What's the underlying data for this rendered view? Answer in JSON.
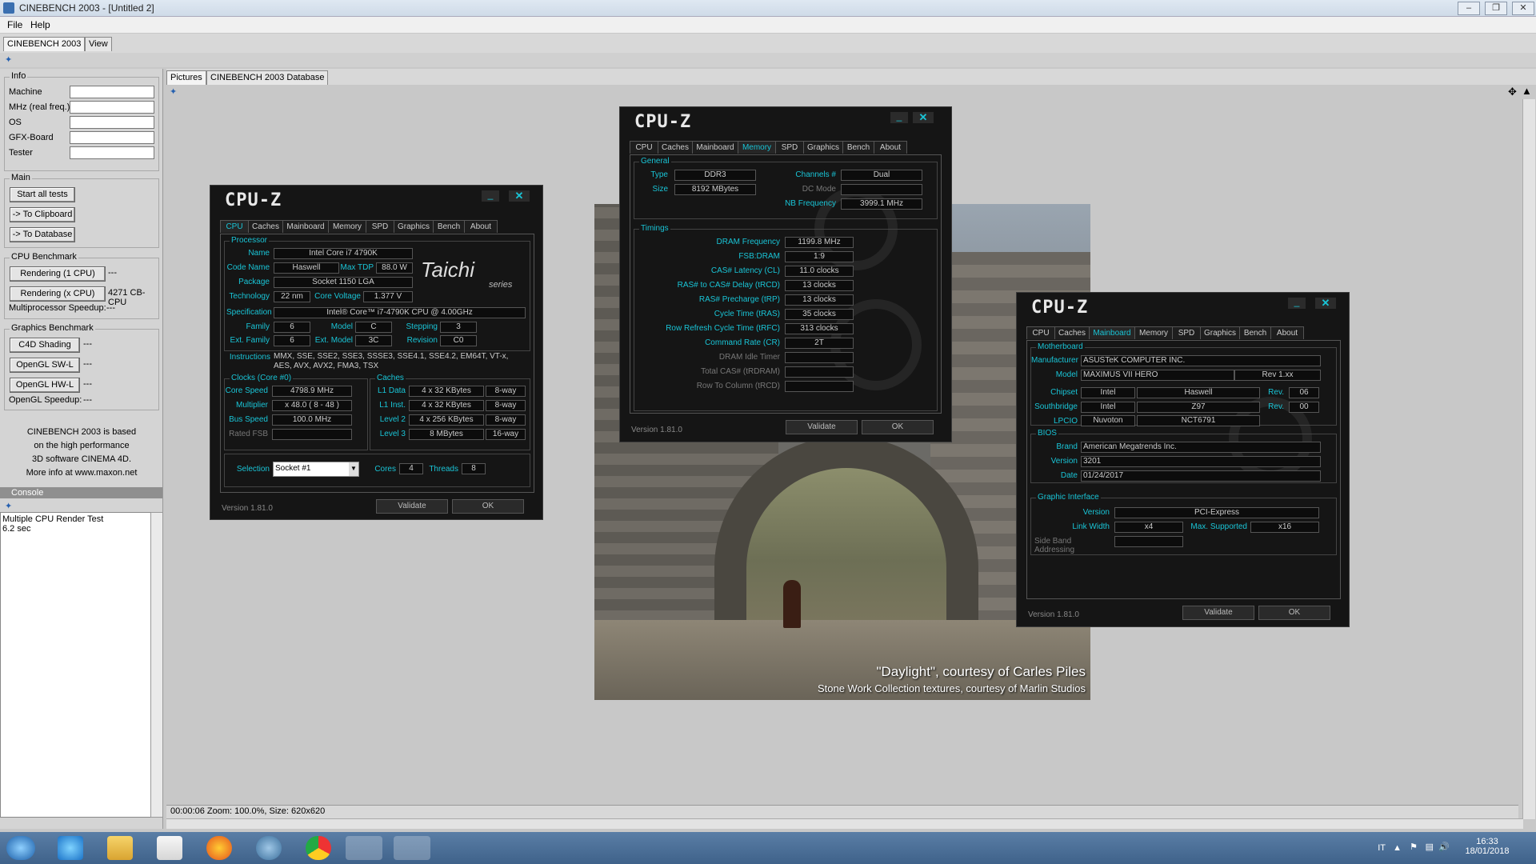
{
  "window": {
    "title": "CINEBENCH 2003 - [Untitled 2]"
  },
  "menu": [
    "File",
    "Help"
  ],
  "top_tabs": [
    "CINEBENCH 2003",
    "View"
  ],
  "info": {
    "label": "Info",
    "fields": [
      "Machine",
      "MHz (real freq.)",
      "OS",
      "GFX-Board",
      "Tester"
    ]
  },
  "main_group": {
    "label": "Main",
    "buttons": [
      "Start all tests",
      "-> To Clipboard",
      "-> To Database"
    ]
  },
  "cpu_bench": {
    "label": "CPU Benchmark",
    "render1": "Rendering (1 CPU)",
    "render1_result": "---",
    "renderx": "Rendering (x CPU)",
    "renderx_result": "4271 CB-CPU",
    "mp_label": "Multiprocessor Speedup:",
    "mp_value": "---"
  },
  "gfx_bench": {
    "label": "Graphics Benchmark",
    "c4d": "C4D Shading",
    "c4d_result": "---",
    "swl": "OpenGL SW-L",
    "swl_result": "---",
    "hwl": "OpenGL HW-L",
    "hwl_result": "---",
    "speedup_label": "OpenGL Speedup:",
    "speedup_value": "---"
  },
  "about_text": [
    "CINEBENCH 2003 is based",
    "on the high performance",
    "3D software CINEMA 4D.",
    "More info at www.maxon.net"
  ],
  "console": {
    "label": "Console",
    "lines": [
      "Multiple CPU Render Test",
      "6.2 sec"
    ]
  },
  "view_tabs": [
    "Pictures",
    "CINEBENCH 2003 Database"
  ],
  "status": "00:00:06  Zoom: 100.0%, Size: 620x620",
  "render_caption": {
    "line1": "\"Daylight\", courtesy of Carles Piles",
    "line2": "Stone Work Collection textures, courtesy of Marlin Studios"
  },
  "cpuz_tabs": [
    "CPU",
    "Caches",
    "Mainboard",
    "Memory",
    "SPD",
    "Graphics",
    "Bench",
    "About"
  ],
  "cpuz_cpu": {
    "logo": "CPU-Z",
    "processor_label": "Processor",
    "name_label": "Name",
    "name": "Intel Core i7 4790K",
    "codename_label": "Code Name",
    "codename": "Haswell",
    "maxtdp_label": "Max TDP",
    "maxtdp": "88.0 W",
    "package_label": "Package",
    "package": "Socket 1150 LGA",
    "tech_label": "Technology",
    "tech": "22 nm",
    "voltage_label": "Core Voltage",
    "voltage": "1.377 V",
    "spec_label": "Specification",
    "spec": "Intel® Core™ i7-4790K CPU @ 4.00GHz",
    "family_label": "Family",
    "family": "6",
    "model_label": "Model",
    "model": "C",
    "stepping_label": "Stepping",
    "stepping": "3",
    "extfamily_label": "Ext. Family",
    "extfamily": "6",
    "extmodel_label": "Ext. Model",
    "extmodel": "3C",
    "revision_label": "Revision",
    "revision": "C0",
    "instr_label": "Instructions",
    "instr": "MMX, SSE, SSE2, SSE3, SSSE3, SSE4.1, SSE4.2, EM64T, VT-x, AES, AVX, AVX2, FMA3, TSX",
    "brand_line1": "Taichi",
    "brand_line2": "series",
    "clocks_label": "Clocks (Core #0)",
    "corespeed_label": "Core Speed",
    "corespeed": "4798.9 MHz",
    "mult_label": "Multiplier",
    "mult": "x 48.0 ( 8 - 48 )",
    "bus_label": "Bus Speed",
    "bus": "100.0 MHz",
    "fsb_label": "Rated FSB",
    "fsb": "",
    "caches_label": "Caches",
    "l1d_label": "L1 Data",
    "l1d": "4 x 32 KBytes",
    "l1d_way": "8-way",
    "l1i_label": "L1 Inst.",
    "l1i": "4 x 32 KBytes",
    "l1i_way": "8-way",
    "l2_label": "Level 2",
    "l2": "4 x 256 KBytes",
    "l2_way": "8-way",
    "l3_label": "Level 3",
    "l3": "8 MBytes",
    "l3_way": "16-way",
    "selection_label": "Selection",
    "selection": "Socket #1",
    "cores_label": "Cores",
    "cores": "4",
    "threads_label": "Threads",
    "threads": "8",
    "version": "Version 1.81.0",
    "validate": "Validate",
    "ok": "OK"
  },
  "cpuz_mem": {
    "logo": "CPU-Z",
    "general_label": "General",
    "type_label": "Type",
    "type": "DDR3",
    "size_label": "Size",
    "size": "8192 MBytes",
    "channels_label": "Channels #",
    "channels": "Dual",
    "dcmode_label": "DC Mode",
    "dcmode": "",
    "nb_label": "NB Frequency",
    "nb": "3999.1 MHz",
    "timings_label": "Timings",
    "dram_label": "DRAM Frequency",
    "dram": "1199.8 MHz",
    "fsbdram_label": "FSB:DRAM",
    "fsbdram": "1:9",
    "cl_label": "CAS# Latency (CL)",
    "cl": "11.0 clocks",
    "trcd_label": "RAS# to CAS# Delay (tRCD)",
    "trcd": "13 clocks",
    "trp_label": "RAS# Precharge (tRP)",
    "trp": "13 clocks",
    "tras_label": "Cycle Time (tRAS)",
    "tras": "35 clocks",
    "trfc_label": "Row Refresh Cycle Time (tRFC)",
    "trfc": "313 clocks",
    "cr_label": "Command Rate (CR)",
    "cr": "2T",
    "idle_label": "DRAM Idle Timer",
    "idle": "",
    "trdram_label": "Total CAS# (tRDRAM)",
    "trdram": "",
    "rtc_label": "Row To Column (tRCD)",
    "rtc": "",
    "version": "Version 1.81.0",
    "validate": "Validate",
    "ok": "OK"
  },
  "cpuz_mb": {
    "logo": "CPU-Z",
    "mb_label": "Motherboard",
    "manu_label": "Manufacturer",
    "manu": "ASUSTeK COMPUTER INC.",
    "model_label": "Model",
    "model": "MAXIMUS VII HERO",
    "model_rev": "Rev 1.xx",
    "chipset_label": "Chipset",
    "chipset_v": "Intel",
    "chipset_n": "Haswell",
    "rev_label": "Rev.",
    "chipset_rev": "06",
    "south_label": "Southbridge",
    "south_v": "Intel",
    "south_n": "Z97",
    "south_rev": "00",
    "lpcio_label": "LPCIO",
    "lpcio_v": "Nuvoton",
    "lpcio_n": "NCT6791",
    "bios_label": "BIOS",
    "brand_label": "Brand",
    "brand": "American Megatrends Inc.",
    "ver_label": "Version",
    "ver": "3201",
    "date_label": "Date",
    "date": "01/24/2017",
    "gi_label": "Graphic Interface",
    "giver_label": "Version",
    "giver": "PCI-Express",
    "lw_label": "Link Width",
    "lw": "x4",
    "maxsup_label": "Max. Supported",
    "maxsup": "x16",
    "sba_label": "Side Band Addressing",
    "sba": "",
    "version": "Version 1.81.0",
    "validate": "Validate",
    "ok": "OK"
  },
  "tray": {
    "lang": "IT",
    "time": "16:33",
    "date": "18/01/2018"
  }
}
